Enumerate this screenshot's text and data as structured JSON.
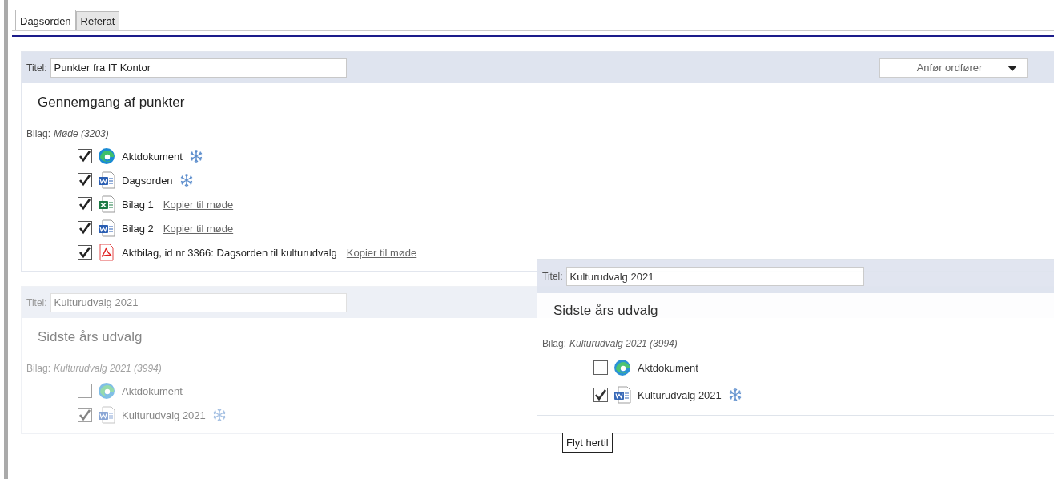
{
  "tabs": [
    {
      "label": "Dagsorden",
      "selected": true
    },
    {
      "label": "Referat",
      "selected": false
    }
  ],
  "agenda_items": [
    {
      "title_label": "Titel:",
      "title": "Punkter fra IT Kontor",
      "speaker_prompt": "Anfør ordfører",
      "heading": "Gennemgang af punkter",
      "bilag_label": "Bilag:",
      "bilag_source": "Møde (3203)",
      "dragging": false,
      "attachments": [
        {
          "kind": "edge",
          "name": "Aktdokument",
          "checked": true,
          "frozen": true
        },
        {
          "kind": "word",
          "name": "Dagsorden",
          "checked": true,
          "frozen": true
        },
        {
          "kind": "excel",
          "name": "Bilag 1",
          "checked": true,
          "frozen": false,
          "action_link": "Kopier til møde"
        },
        {
          "kind": "word",
          "name": "Bilag 2",
          "checked": true,
          "frozen": false,
          "action_link": "Kopier til møde"
        },
        {
          "kind": "pdf",
          "name": "Aktbilag, id nr 3366: Dagsorden til kulturudvalg",
          "checked": true,
          "frozen": false,
          "action_link": "Kopier til møde"
        }
      ]
    },
    {
      "title_label": "Titel:",
      "title": "Kulturudvalg 2021",
      "heading": "Sidste års udvalg",
      "bilag_label": "Bilag:",
      "bilag_source": "Kulturudvalg 2021 (3994)",
      "dragging": true,
      "attachments": [
        {
          "kind": "edge",
          "name": "Aktdokument",
          "checked": false,
          "frozen": false
        },
        {
          "kind": "word",
          "name": "Kulturudvalg 2021",
          "checked": true,
          "frozen": true
        }
      ]
    }
  ],
  "drag_preview": {
    "title_label": "Titel:",
    "title": "Kulturudvalg 2021",
    "heading": "Sidste års udvalg",
    "bilag_label": "Bilag:",
    "bilag_source": "Kulturudvalg 2021 (3994)",
    "attachments": [
      {
        "kind": "edge",
        "name": "Aktdokument",
        "checked": false,
        "frozen": false
      },
      {
        "kind": "word",
        "name": "Kulturudvalg 2021",
        "checked": true,
        "frozen": true
      }
    ]
  },
  "drop_tooltip": "Flyt hertil"
}
